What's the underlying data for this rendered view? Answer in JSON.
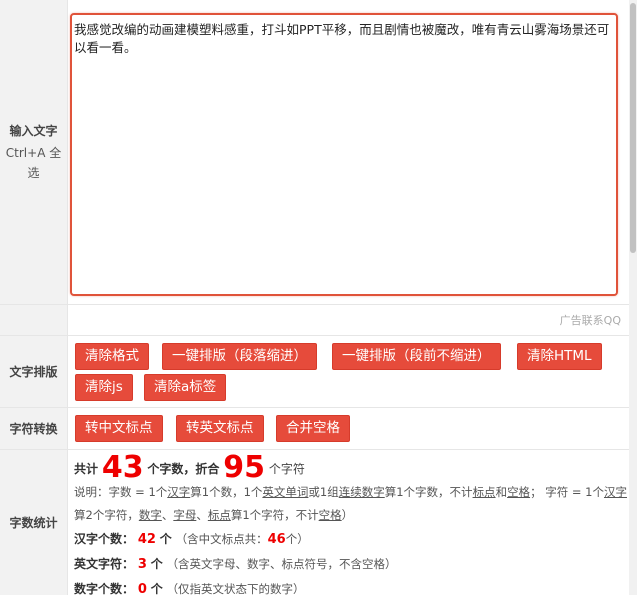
{
  "input": {
    "label": "输入文字",
    "hint": "Ctrl+A 全选",
    "value": "我感觉改编的动画建模塑料感重，打斗如PPT平移，而且剧情也被魔改，唯有青云山雾海场景还可以看一看。"
  },
  "ad": {
    "contact": "广告联系QQ"
  },
  "layout": {
    "label": "文字排版",
    "buttons": [
      "清除格式",
      "一键排版（段落缩进）",
      "一键排版（段前不缩进）",
      "清除HTML",
      "清除js",
      "清除a标签"
    ]
  },
  "convert": {
    "label": "字符转换",
    "buttons": [
      "转中文标点",
      "转英文标点",
      "合并空格"
    ]
  },
  "stats": {
    "label": "字数统计",
    "total_prefix": "共计",
    "total_count": "43",
    "total_unit": "个字数，折合",
    "char_count": "95",
    "char_unit": "个字符",
    "desc_1": "说明：字数 = 1个",
    "desc_hanzi": "汉字",
    "desc_2": "算1个数，1个",
    "desc_word": "英文单词",
    "desc_3": "或1组",
    "desc_digits": "连续数字",
    "desc_4": "算1个字数，不计",
    "desc_punct": "标点",
    "desc_5": "和",
    "desc_space": "空格",
    "desc_6": "； 字符 = 1个",
    "desc_hanzi2": "汉字",
    "desc_7": "算2个字符，",
    "desc_num": "数字",
    "desc_sep1": "、",
    "desc_letter": "字母",
    "desc_sep2": "、",
    "desc_punct2": "标点",
    "desc_8": "算1个字符，不计",
    "desc_space2": "空格",
    "desc_9": "）",
    "hanzi_label": "汉字个数：",
    "hanzi_count": "42",
    "hanzi_unit": "个",
    "hanzi_note_pre": "（含中文标点共：",
    "hanzi_note_count": "46",
    "hanzi_note_post": "个）",
    "en_label": "英文字符：",
    "en_count": "3",
    "en_unit": "个",
    "en_note": "（含英文字母、数字、标点符号，不含空格）",
    "num_label": "数字个数：",
    "num_count": "0",
    "num_unit": "个",
    "num_note": "（仅指英文状态下的数字）"
  }
}
